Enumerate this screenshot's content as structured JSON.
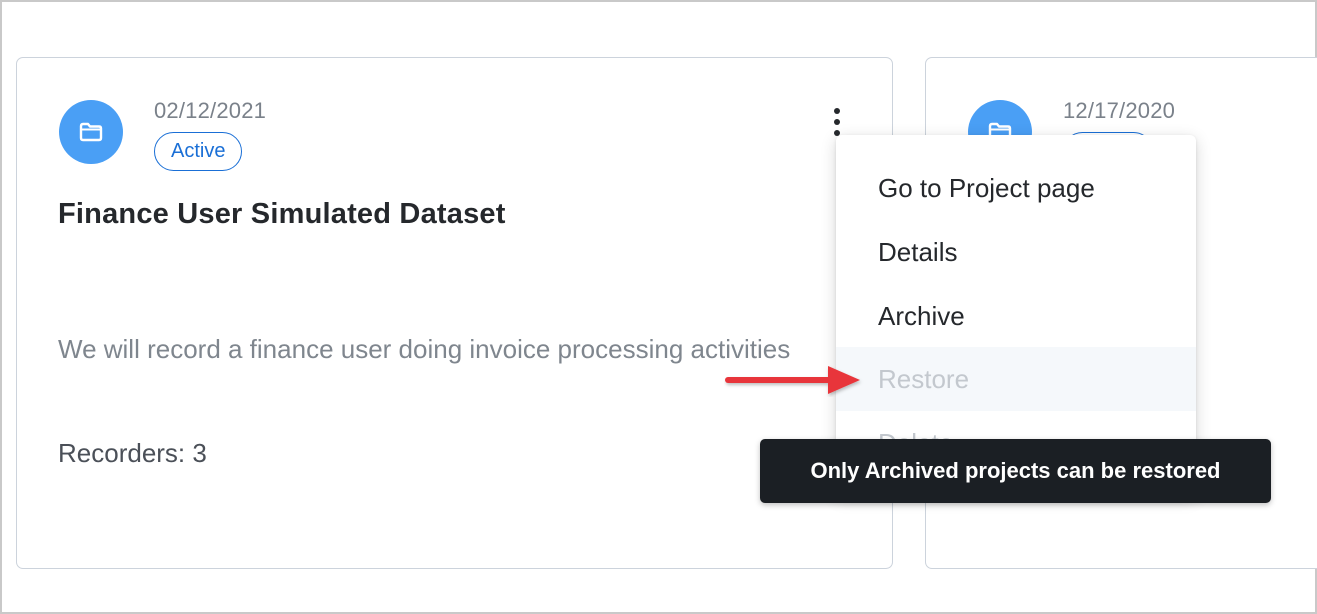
{
  "card1": {
    "date": "02/12/2021",
    "status": "Active",
    "title": "Finance User Simulated Dataset",
    "description": "We will record a finance user doing invoice processing activities",
    "recorders": "Recorders: 3"
  },
  "card2": {
    "date": "12/17/2020",
    "status": ""
  },
  "menu": {
    "items": [
      {
        "label": "Go to Project page"
      },
      {
        "label": "Details"
      },
      {
        "label": "Archive"
      },
      {
        "label": "Restore"
      },
      {
        "label": "Delete"
      }
    ]
  },
  "tooltip": {
    "text": "Only Archived projects can be restored"
  },
  "colors": {
    "accent": "#4a9ff5",
    "badge": "#1a6fd6",
    "arrow": "#e8363a",
    "tooltip_bg": "#1b1f24"
  },
  "icons": {
    "folder": "folder-icon",
    "more": "kebab-menu-icon"
  }
}
